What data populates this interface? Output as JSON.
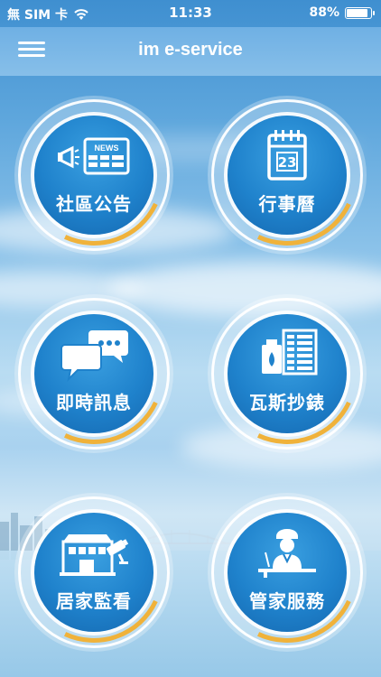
{
  "status_bar": {
    "carrier": "無 SIM 卡",
    "time": "11:33",
    "battery_percent": "88%",
    "battery_level": 0.88
  },
  "nav": {
    "title": "im e-service",
    "menu_icon": "hamburger-menu-icon"
  },
  "tiles": [
    {
      "label": "社區公告",
      "icon": "megaphone-news-icon"
    },
    {
      "label": "行事曆",
      "icon": "calendar-icon",
      "icon_text": "23"
    },
    {
      "label": "即時訊息",
      "icon": "chat-bubbles-icon"
    },
    {
      "label": "瓦斯抄錶",
      "icon": "gas-meter-icon"
    },
    {
      "label": "居家監看",
      "icon": "home-camera-icon"
    },
    {
      "label": "管家服務",
      "icon": "concierge-icon"
    }
  ],
  "news_icon_text": "NEWS",
  "colors": {
    "accent_arc": "#f0b23a",
    "tile_blue": "#1f82cc",
    "nav_blue": "#6fb0e4"
  }
}
